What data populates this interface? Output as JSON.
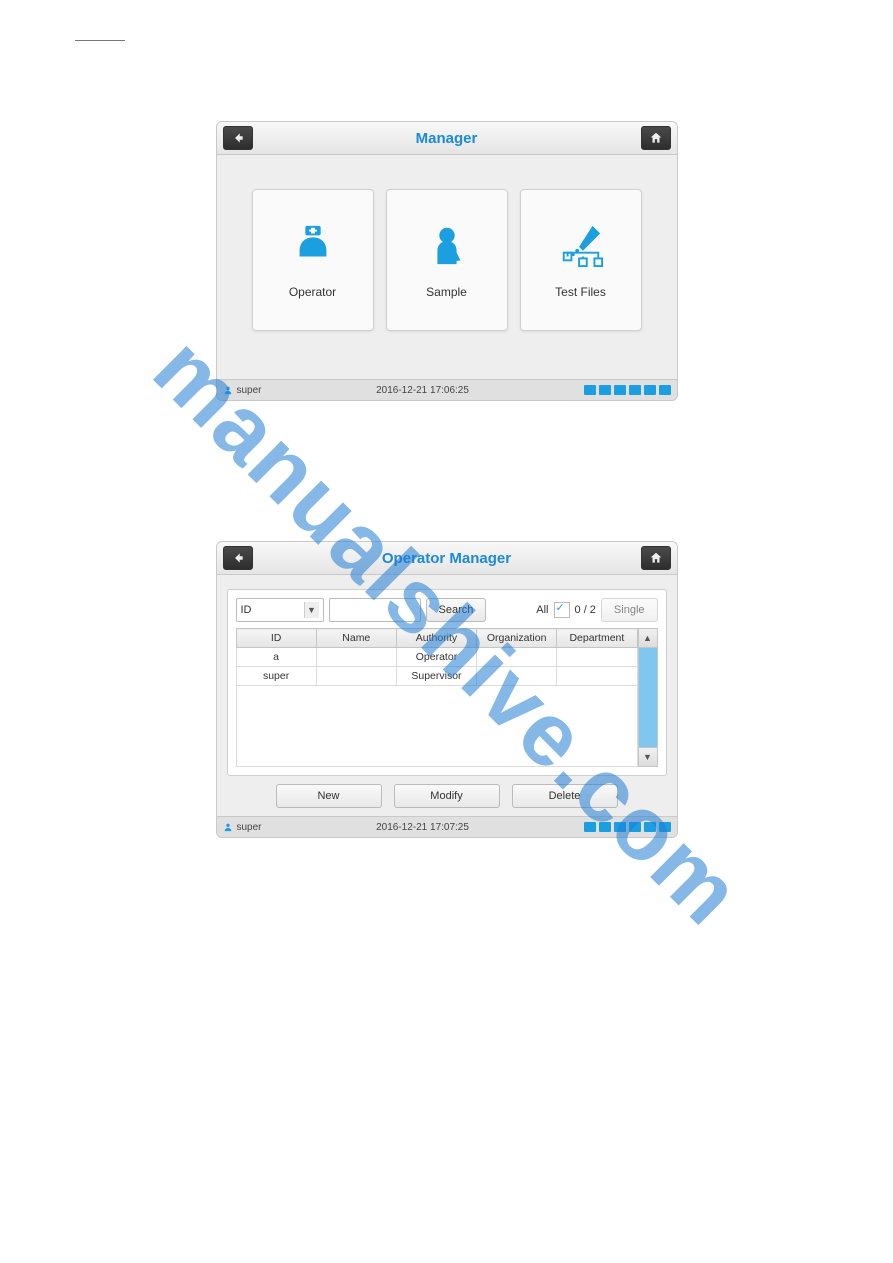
{
  "watermark": "manualshive.com",
  "screen1": {
    "title": "Manager",
    "cards": {
      "operator": "Operator",
      "sample": "Sample",
      "testfiles": "Test Files"
    },
    "status": {
      "user": "super",
      "datetime": "2016-12-21 17:06:25"
    }
  },
  "screen2": {
    "title": "Operator Manager",
    "filter": {
      "dropdown_value": "ID",
      "search_label": "Search",
      "all_label": "All",
      "counter": "0 / 2",
      "single_label": "Single"
    },
    "table": {
      "headers": {
        "id": "ID",
        "name": "Name",
        "authority": "Authority",
        "organization": "Organization",
        "department": "Department"
      },
      "rows": [
        {
          "id": "a",
          "name": "",
          "authority": "Operator",
          "organization": "",
          "department": ""
        },
        {
          "id": "super",
          "name": "",
          "authority": "Supervisor",
          "organization": "",
          "department": ""
        }
      ]
    },
    "actions": {
      "new": "New",
      "modify": "Modify",
      "delete": "Delete"
    },
    "status": {
      "user": "super",
      "datetime": "2016-12-21 17:07:25"
    }
  }
}
